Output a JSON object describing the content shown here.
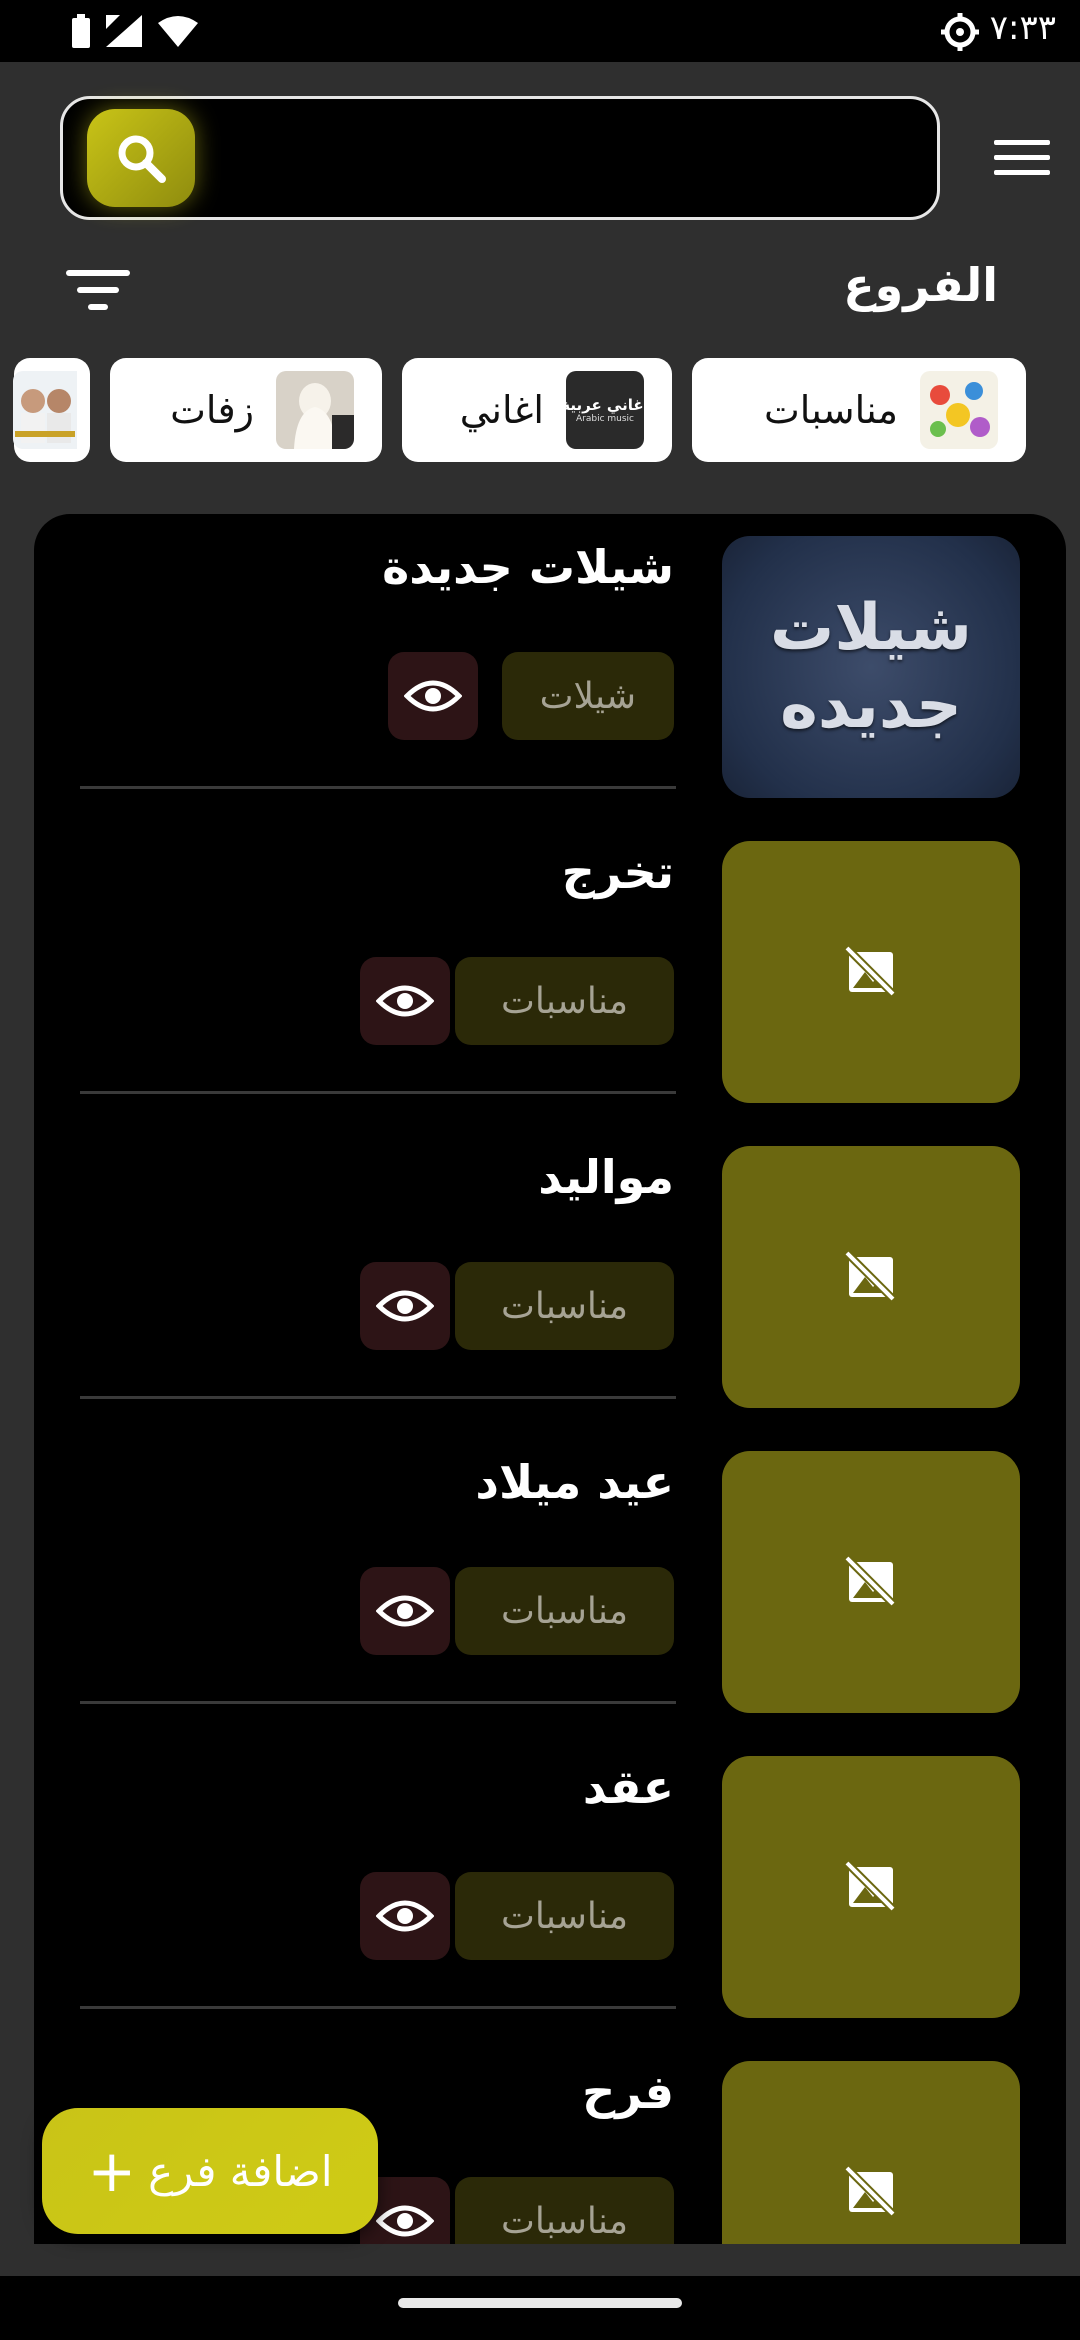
{
  "status_bar": {
    "time": "٧:٣٣"
  },
  "header": {
    "menu_icon": "hamburger-menu-icon",
    "search_icon": "search-icon",
    "search_placeholder": ""
  },
  "section": {
    "title": "الفروع",
    "filter_icon": "filter-icon"
  },
  "categories": [
    {
      "label": "مناسبات",
      "thumb": "party-image"
    },
    {
      "label": "اغاني",
      "thumb_text": "اغاني عربية",
      "thumb_sub": "Arabic music"
    },
    {
      "label": "زفات",
      "thumb": "wedding-image"
    },
    {
      "label": "",
      "thumb": "people-image"
    }
  ],
  "branches": [
    {
      "title": "شيلات جديدة",
      "tag": "شيلات",
      "thumb_text": [
        "شيلات",
        "جديده"
      ]
    },
    {
      "title": "تخرج",
      "tag": "مناسبات"
    },
    {
      "title": "مواليد",
      "tag": "مناسبات"
    },
    {
      "title": "عيد ميلاد",
      "tag": "مناسبات"
    },
    {
      "title": "عقد",
      "tag": "مناسبات"
    },
    {
      "title": "فرح",
      "tag": "مناسبات"
    }
  ],
  "fab": {
    "label": "اضافة فرع",
    "icon": "plus-icon"
  },
  "colors": {
    "accent": "#c9c417",
    "placeholder_thumb": "#6b6710",
    "tag_bg": "#2b2908",
    "eye_bg": "#2d1416"
  }
}
